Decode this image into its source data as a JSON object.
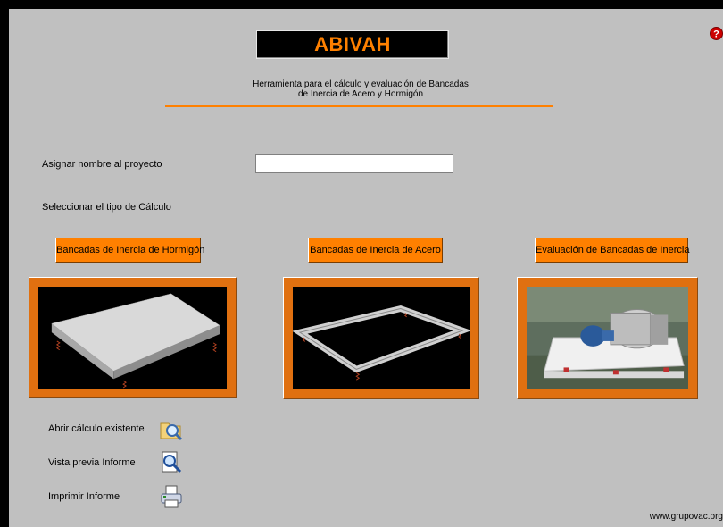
{
  "app": {
    "title": "ABIVAH",
    "subtitle_line1": "Herramienta para el  cálculo y evaluación de Bancadas",
    "subtitle_line2": "de Inercia de Acero y Hormigón"
  },
  "project": {
    "label": "Asignar nombre al proyecto",
    "value": "",
    "placeholder": ""
  },
  "calc_type": {
    "label": "Seleccionar el tipo de Cálculo",
    "options": [
      {
        "label": "Bancadas de Inercia de Hormigón",
        "image": "concrete-inertia-base"
      },
      {
        "label": "Bancadas de Inercia de Acero",
        "image": "steel-frame-inertia-base"
      },
      {
        "label": "Evaluación de Bancadas de Inercia",
        "image": "motor-pump-on-base-photo"
      }
    ]
  },
  "actions": [
    {
      "label": "Abrir cálculo existente",
      "icon": "folder-search-icon"
    },
    {
      "label": "Vista previa Informe",
      "icon": "print-preview-icon"
    },
    {
      "label": "Imprimir Informe",
      "icon": "printer-icon"
    }
  ],
  "footer": {
    "url": "www.grupovac.org"
  },
  "colors": {
    "accent": "#ff8000",
    "background": "#c0c0c0",
    "title_bg": "#000000"
  },
  "icons": {
    "help": "help-icon"
  }
}
